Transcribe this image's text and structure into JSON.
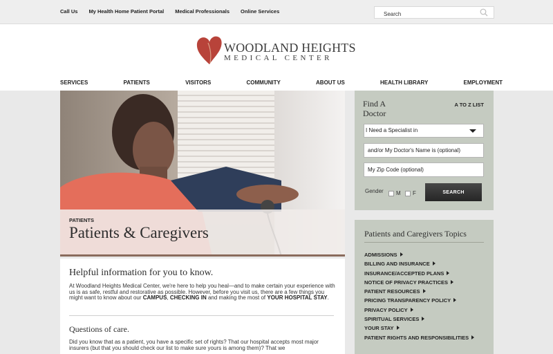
{
  "topbar": {
    "links": [
      "Call Us",
      "My Health Home Patient Portal",
      "Medical Professionals",
      "Online Services"
    ],
    "search_placeholder": "Search"
  },
  "logo": {
    "line1": "WOODLAND HEIGHTS",
    "line2": "MEDICAL CENTER"
  },
  "nav": [
    "SERVICES",
    "PATIENTS",
    "VISITORS",
    "COMMUNITY",
    "ABOUT US",
    "HEALTH LIBRARY",
    "EMPLOYMENT"
  ],
  "hero": {
    "kicker": "PATIENTS",
    "title": "Patients & Caregivers"
  },
  "article": {
    "heading": "Helpful information for you to know.",
    "intro_pre": "At Woodland Heights Medical Center, we're here to help you heal—and to make certain your experience with us is as safe, restful and restorative as possible. However, before you visit us, there are a few things you might want to know about our ",
    "campus": "CAMPUS",
    "comma": ", ",
    "checking_in": "CHECKING IN",
    "and_making": " and making the most of ",
    "your_stay": "YOUR HOSPITAL STAY",
    "period": ".",
    "subheading": "Questions of care.",
    "p2": "Did you know that as a patient, you have a specific set of rights? That our hospital accepts most major insurers (but that you should check our list to make sure yours is among them)? That we"
  },
  "find_doctor": {
    "title": "Find A Doctor",
    "atoz": "A TO Z LIST",
    "specialist_select": "I Need a Specialist in",
    "doctor_name_placeholder": "and/or My Doctor's Name is (optional)",
    "zip_placeholder": "My Zip Code (optional)",
    "gender_label": "Gender",
    "male_label": "M",
    "female_label": "F",
    "search_button": "SEARCH"
  },
  "topics": {
    "title": "Patients and Caregivers Topics",
    "items": [
      "ADMISSIONS",
      "BILLING AND INSURANCE",
      "INSURANCE/ACCEPTED PLANS",
      "NOTICE OF PRIVACY PRACTICES",
      "PATIENT RESOURCES",
      "PRICING TRANSPARENCY POLICY",
      "PRIVACY POLICY",
      "SPIRITUAL SERVICES",
      "YOUR STAY",
      "PATIENT RIGHTS AND RESPONSIBILITIES"
    ]
  },
  "colors": {
    "sidebar_bg": "#c5cbc1",
    "heart": "#b8433a",
    "topbar_bg": "#eeeeee"
  }
}
